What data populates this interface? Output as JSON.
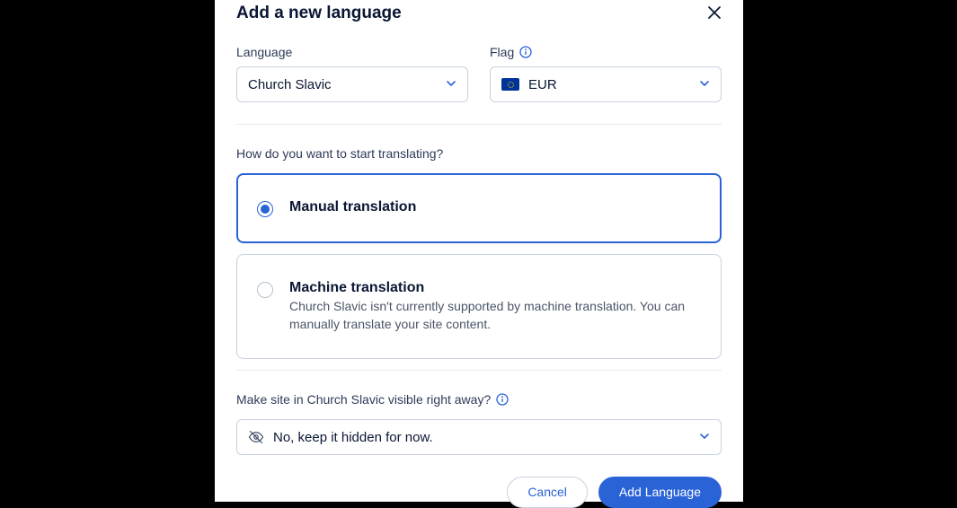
{
  "modal": {
    "title": "Add a new language",
    "language_field": {
      "label": "Language",
      "value": "Church Slavic"
    },
    "flag_field": {
      "label": "Flag",
      "value": "EUR"
    },
    "translate_section_label": "How do you want to start translating?",
    "option_manual": {
      "title": "Manual translation"
    },
    "option_machine": {
      "title": "Machine translation",
      "description": "Church Slavic isn't currently supported by machine translation. You can manually translate your site content."
    },
    "visibility": {
      "label": "Make site in Church Slavic visible right away?",
      "value": "No, keep it hidden for now."
    },
    "buttons": {
      "cancel": "Cancel",
      "add": "Add Language"
    }
  }
}
